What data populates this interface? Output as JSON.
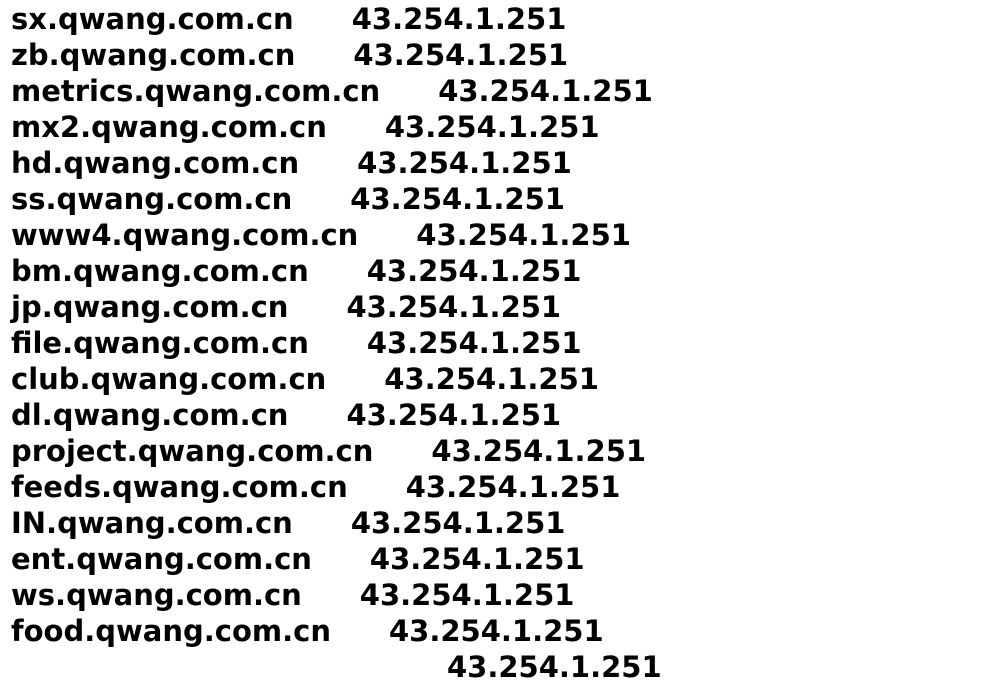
{
  "records": [
    {
      "host": "sx.qwang.com.cn",
      "ip": "43.254.1.251"
    },
    {
      "host": "zb.qwang.com.cn",
      "ip": "43.254.1.251"
    },
    {
      "host": "metrics.qwang.com.cn",
      "ip": "43.254.1.251"
    },
    {
      "host": "mx2.qwang.com.cn",
      "ip": "43.254.1.251"
    },
    {
      "host": "hd.qwang.com.cn",
      "ip": "43.254.1.251"
    },
    {
      "host": "ss.qwang.com.cn",
      "ip": "43.254.1.251"
    },
    {
      "host": "www4.qwang.com.cn",
      "ip": "43.254.1.251"
    },
    {
      "host": "bm.qwang.com.cn",
      "ip": "43.254.1.251"
    },
    {
      "host": "jp.qwang.com.cn",
      "ip": "43.254.1.251"
    },
    {
      "host": "file.qwang.com.cn",
      "ip": "43.254.1.251"
    },
    {
      "host": "club.qwang.com.cn",
      "ip": "43.254.1.251"
    },
    {
      "host": "dl.qwang.com.cn",
      "ip": "43.254.1.251"
    },
    {
      "host": "project.qwang.com.cn",
      "ip": "43.254.1.251"
    },
    {
      "host": "feeds.qwang.com.cn",
      "ip": "43.254.1.251"
    },
    {
      "host": "IN.qwang.com.cn",
      "ip": "43.254.1.251"
    },
    {
      "host": "ent.qwang.com.cn",
      "ip": "43.254.1.251"
    },
    {
      "host": "ws.qwang.com.cn",
      "ip": "43.254.1.251"
    },
    {
      "host": "food.qwang.com.cn",
      "ip": "43.254.1.251"
    },
    {
      "host": "",
      "ip": "43.254.1.251"
    }
  ]
}
